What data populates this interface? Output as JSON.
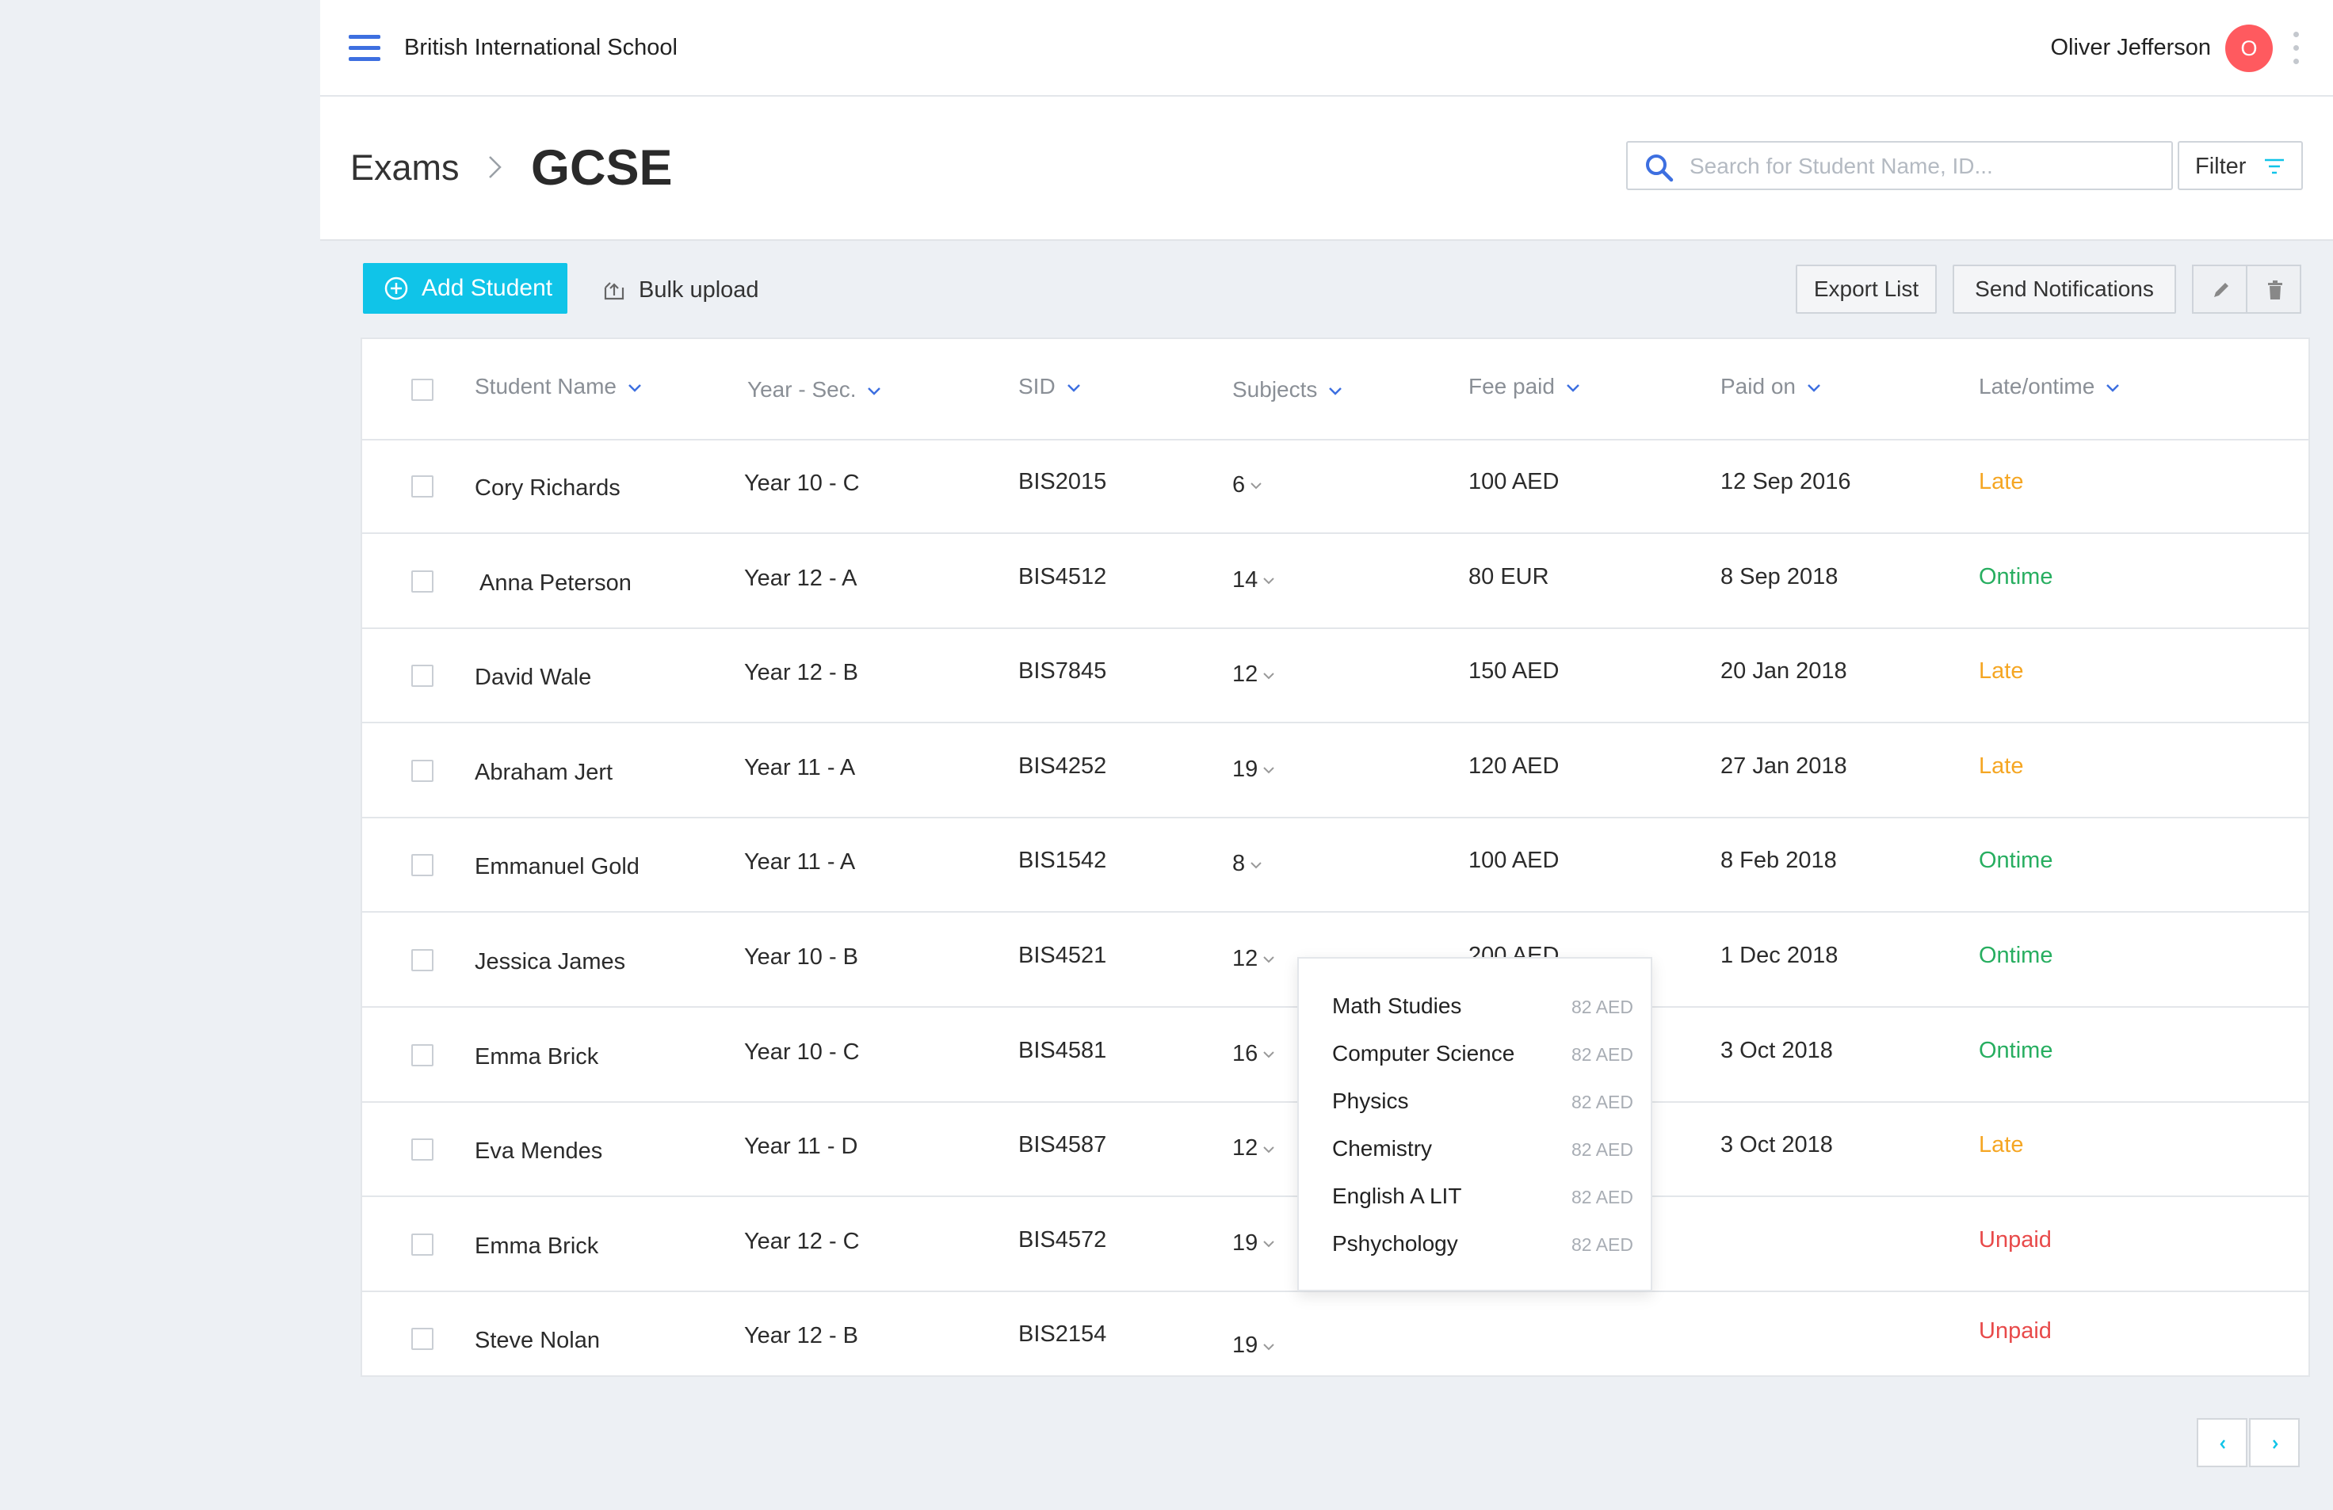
{
  "app": {
    "school_name": "British International School",
    "user_name": "Oliver Jefferson",
    "user_initial": "O"
  },
  "breadcrumb": {
    "parent": "Exams",
    "separator": ">",
    "current": "GCSE"
  },
  "search": {
    "placeholder": "Search for Student Name, ID..."
  },
  "filter": {
    "label": "Filter"
  },
  "toolbar": {
    "add_student": "Add Student",
    "bulk_upload": "Bulk upload",
    "export_list": "Export List",
    "send_notifications": "Send Notifications"
  },
  "table": {
    "headers": [
      "Student Name",
      "Year - Sec.",
      "SID",
      "Subjects",
      "Fee paid",
      "Paid on",
      "Late/ontime"
    ],
    "rows": [
      {
        "name": "Cory Richards",
        "year": "Year 10 - C",
        "sid": "BIS2015",
        "subjects": "6",
        "fee": "100 AED",
        "paid_on": "12 Sep 2016",
        "status": "Late"
      },
      {
        "name": "Anna Peterson",
        "year": "Year 12 - A",
        "sid": "BIS4512",
        "subjects": "14",
        "fee": "80 EUR",
        "paid_on": "8 Sep 2018",
        "status": "Ontime"
      },
      {
        "name": "David Wale",
        "year": "Year 12 - B",
        "sid": "BIS7845",
        "subjects": "12",
        "fee": "150 AED",
        "paid_on": "20 Jan 2018",
        "status": "Late"
      },
      {
        "name": "Abraham Jert",
        "year": "Year 11 - A",
        "sid": "BIS4252",
        "subjects": "19",
        "fee": "120 AED",
        "paid_on": "27 Jan 2018",
        "status": "Late"
      },
      {
        "name": "Emmanuel Gold",
        "year": "Year 11 - A",
        "sid": "BIS1542",
        "subjects": "8",
        "fee": "100 AED",
        "paid_on": "8 Feb 2018",
        "status": "Ontime"
      },
      {
        "name": "Jessica James",
        "year": "Year 10 - B",
        "sid": "BIS4521",
        "subjects": "12",
        "fee": "200 AED",
        "paid_on": "1 Dec 2018",
        "status": "Ontime"
      },
      {
        "name": "Emma Brick",
        "year": "Year 10 - C",
        "sid": "BIS4581",
        "subjects": "16",
        "fee": "",
        "paid_on": "3 Oct 2018",
        "status": "Ontime"
      },
      {
        "name": "Eva Mendes",
        "year": "Year 11 - D",
        "sid": "BIS4587",
        "subjects": "12",
        "fee": "",
        "paid_on": "3 Oct 2018",
        "status": "Late"
      },
      {
        "name": "Emma Brick",
        "year": "Year 12 - C",
        "sid": "BIS4572",
        "subjects": "19",
        "fee": "",
        "paid_on": "",
        "status": "Unpaid"
      },
      {
        "name": "Steve Nolan",
        "year": "Year 12 - B",
        "sid": "BIS2154",
        "subjects": "19",
        "fee": "",
        "paid_on": "",
        "status": "Unpaid"
      }
    ]
  },
  "subjects_popover": {
    "items": [
      {
        "name": "Math Studies",
        "price": "82 AED"
      },
      {
        "name": "Computer Science",
        "price": "82 AED"
      },
      {
        "name": "Physics",
        "price": "82 AED"
      },
      {
        "name": "Chemistry",
        "price": "82 AED"
      },
      {
        "name": "English A LIT",
        "price": "82 AED"
      },
      {
        "name": "Pshychology",
        "price": "82 AED"
      }
    ]
  },
  "colors": {
    "accent": "#10c4e8",
    "brand_blue": "#3d6fe0",
    "avatar": "#ff5a5f",
    "late": "#f5a623",
    "ontime": "#27ae60",
    "unpaid": "#e84a4a"
  },
  "icons": [
    "menu-icon",
    "more-vertical-icon",
    "search-icon",
    "filter-icon",
    "plus-circle-icon",
    "upload-icon",
    "pencil-icon",
    "trash-icon",
    "chevron-left-icon",
    "chevron-right-icon",
    "sort-down-icon",
    "chevron-down-icon"
  ]
}
